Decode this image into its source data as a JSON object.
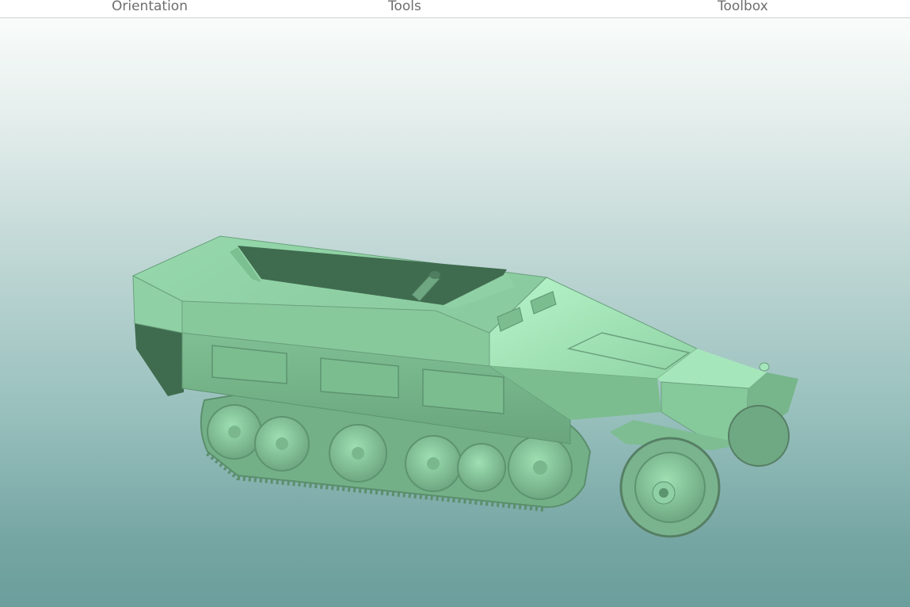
{
  "menu": {
    "orientation_label": "Orientation",
    "tools_label": "Tools",
    "toolbox_label": "Toolbox"
  },
  "viewport": {
    "model_name": "halftrack-model",
    "model_color": "#8fd0a4",
    "background_top": "#ffffff",
    "background_bottom": "#6b9e9c"
  }
}
